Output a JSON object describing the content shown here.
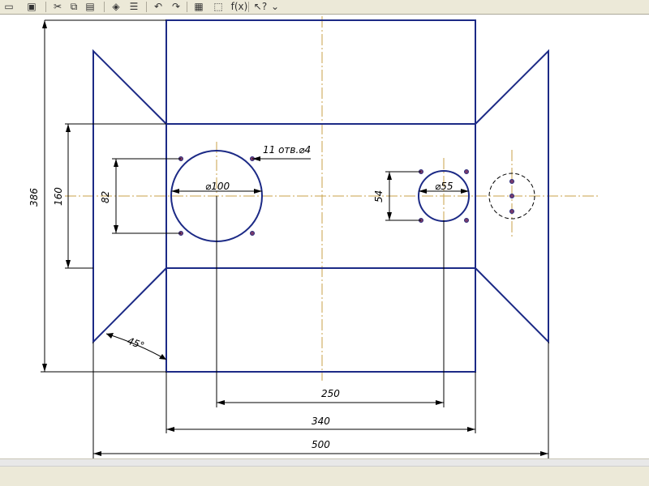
{
  "toolbar": {
    "buttons": [
      {
        "name": "open-folder-icon",
        "glyph": "▭"
      },
      {
        "name": "save-icon",
        "glyph": "▣"
      },
      {
        "name": "cut-icon",
        "glyph": "✂"
      },
      {
        "name": "copy-icon",
        "glyph": "⧉"
      },
      {
        "name": "paste-icon",
        "glyph": "▤"
      },
      {
        "name": "format-brush-icon",
        "glyph": "◈"
      },
      {
        "name": "properties-icon",
        "glyph": "☰"
      },
      {
        "name": "undo-icon",
        "glyph": "↶"
      },
      {
        "name": "redo-icon",
        "glyph": "↷"
      },
      {
        "name": "tree-icon",
        "glyph": "▦"
      },
      {
        "name": "libraries-icon",
        "glyph": "⬚"
      },
      {
        "name": "function-label",
        "glyph": "f(x)"
      },
      {
        "name": "help-pointer-icon",
        "glyph": "↖?"
      },
      {
        "name": "toolbar-overflow-icon",
        "glyph": "⌄"
      }
    ]
  },
  "drawing": {
    "colors": {
      "outline": "#1c2a86",
      "dimension": "#000000",
      "axis": "#c8a24a",
      "hole": "#7a3c6b"
    },
    "dimensions": {
      "height_total": "386",
      "height_middle": "160",
      "hole_spacing_left": "82",
      "hole_spacing_right": "54",
      "circle_large": "⌀100",
      "circle_small": "⌀55",
      "holes_note": "11 отв.⌀4",
      "angle": "45°",
      "center_distance": "250",
      "width_middle": "340",
      "width_total": "500"
    }
  }
}
